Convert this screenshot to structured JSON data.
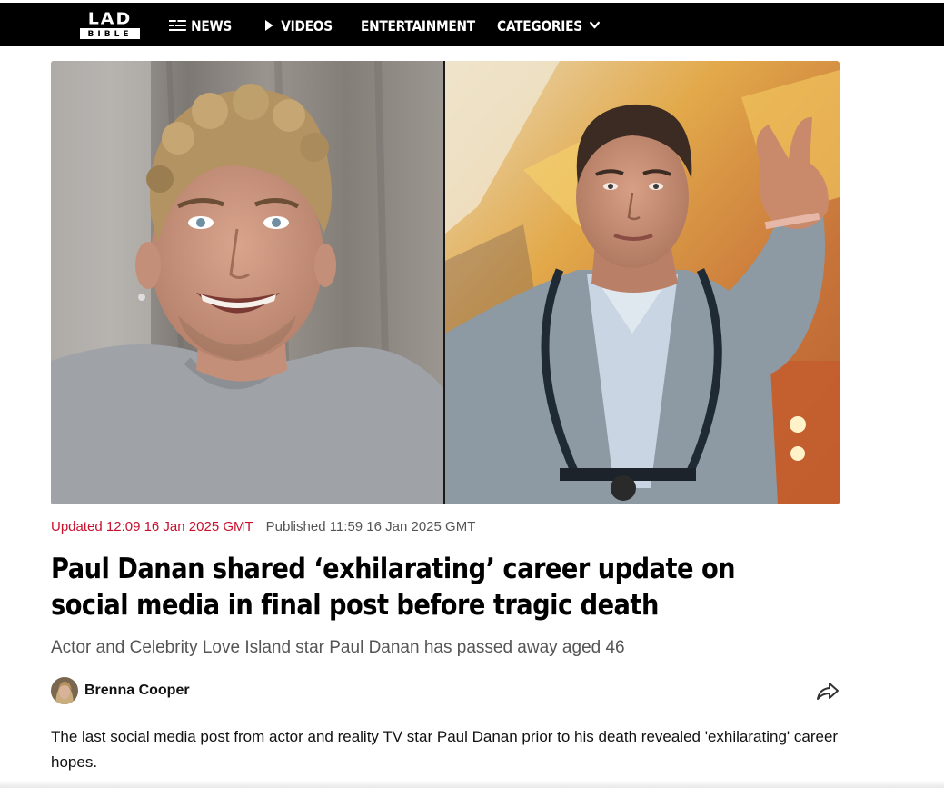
{
  "site": {
    "logo_top": "LAD",
    "logo_bottom": "BIBLE"
  },
  "nav": [
    {
      "label": "NEWS",
      "icon": "news-lines-icon"
    },
    {
      "label": "VIDEOS",
      "icon": "play-icon"
    },
    {
      "label": "ENTERTAINMENT"
    },
    {
      "label": "CATEGORIES",
      "icon": "chevron-down-icon"
    }
  ],
  "article": {
    "updated": "Updated 12:09 16 Jan 2025 GMT",
    "published": "Published 11:59 16 Jan 2025 GMT",
    "headline": "Paul Danan shared ‘exhilarating’ career update on social media in final post before tragic death",
    "standfirst": "Actor and Celebrity Love Island star Paul Danan has passed away aged 46",
    "author": "Brenna Cooper",
    "body": "The last social media post from actor and reality TV star Paul Danan prior to his death revealed 'exhilarating' career hopes."
  },
  "colors": {
    "nav_background": "#000000",
    "updated_red": "#c8102e",
    "meta_grey": "#555555"
  }
}
